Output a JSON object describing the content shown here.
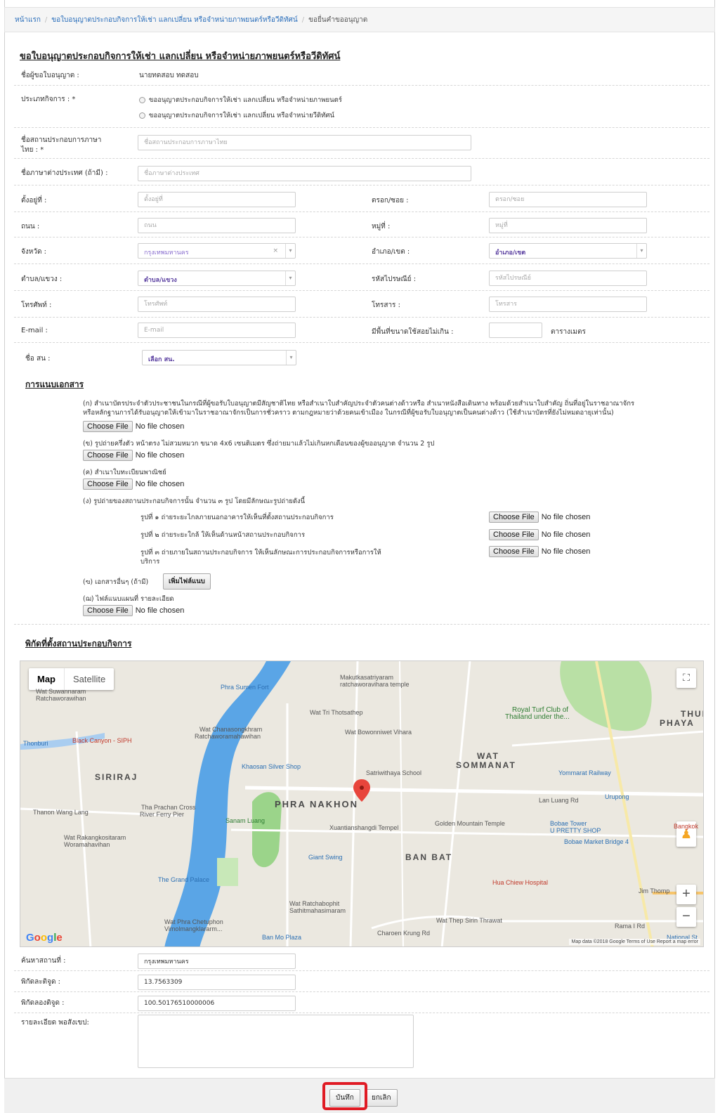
{
  "breadcrumb": {
    "home": "หน้าแรก",
    "section": "ขอใบอนุญาตประกอบกิจการให้เช่า แลกเปลี่ยน หรือจำหน่ายภาพยนตร์หรือวีดิทัศน์",
    "current": "ขอยื่นคำขออนุญาต"
  },
  "form": {
    "title": "ขอใบอนุญาตประกอบกิจการให้เช่า แลกเปลี่ยน หรือจำหน่ายภาพยนตร์หรือวีดิทัศน์",
    "applicant_label": "ชื่อผู้ขอใบอนุญาต :",
    "applicant_value": "นายทดสอบ ทดสอบ",
    "business_type_label": "ประเภทกิจการ : *",
    "business_type_options": [
      "ขออนุญาตประกอบกิจการให้เช่า แลกเปลี่ยน หรือจำหน่ายภาพยนตร์",
      "ขออนุญาตประกอบกิจการให้เช่า แลกเปลี่ยน หรือจำหน่ายวีดิทัศน์"
    ],
    "thai_name_label_1": "ชื่อสถานประกอบการภาษา",
    "thai_name_label_2": "ไทย : *",
    "thai_name_placeholder": "ชื่อสถานประกอบการภาษาไทย",
    "foreign_name_label": "ชื่อภาษาต่างประเทศ (ถ้ามี) :",
    "foreign_name_placeholder": "ชื่อภาษาต่างประเทศ",
    "address_label": "ตั้งอยู่ที่ :",
    "address_placeholder": "ตั้งอยู่ที่",
    "alley_label": "ตรอก/ซอย :",
    "alley_placeholder": "ตรอก/ซอย",
    "road_label": "ถนน :",
    "road_placeholder": "ถนน",
    "moo_label": "หมู่ที่ :",
    "moo_placeholder": "หมู่ที่",
    "province_label": "จังหวัด :",
    "province_value": "กรุงเทพมหานคร",
    "district_label": "อำเภอ/เขต :",
    "district_value": "อำเภอ/เขต",
    "subdistrict_label": "ตำบล/แขวง :",
    "subdistrict_value": "ตำบล/แขวง",
    "postcode_label": "รหัสไปรษณีย์ :",
    "postcode_placeholder": "รหัสไปรษณีย์",
    "phone_label": "โทรศัพท์ :",
    "phone_placeholder": "โทรศัพท์",
    "fax_label": "โทรสาร :",
    "fax_placeholder": "โทรสาร",
    "email_label": "E-mail :",
    "email_placeholder": "E-mail",
    "area_label": "มีพื้นที่ขนาดใช้สอยไม่เกิน :",
    "area_unit": "ตารางเมตร",
    "office_label": "ชื่อ สน :",
    "office_value": "เลือก สน."
  },
  "documents": {
    "title": "การแนบเอกสาร",
    "doc_a_line1": "(ก) สำเนาบัตรประจำตัวประชาชนในกรณีที่ผู้ขอรับใบอนุญาตมีสัญชาติไทย หรือสำเนาใบสำคัญประจำตัวคนต่างด้าวหรือ สำเนาหนังสือเดินทาง พร้อมด้วยสำเนาใบสำคัญ ถิ่นที่อยู่ในราชอาณาจักร",
    "doc_a_line2": "หรือหลักฐานการได้รับอนุญาตให้เข้ามาในราชอาณาจักรเป็นการชั่วคราว ตามกฎหมายว่าด้วยคนเข้าเมือง ในกรณีที่ผู้ขอรับใบอนุญาตเป็นคนต่างด้าว (ใช้สำเนาบัตรที่ยังไม่หมดอายุเท่านั้น)",
    "doc_b": "(ข) รูปถ่ายครึ่งตัว หน้าตรง ไม่สวมหมวก ขนาด 4x6 เซนติเมตร ซึ่งถ่ายมาแล้วไม่เกินหกเดือนของผู้ขออนุญาต จำนวน 2 รูป",
    "doc_c": "(ค) สำเนาใบทะเบียนพาณิชย์",
    "doc_d": "(ง) รูปถ่ายของสถานประกอบกิจการนั้น จำนวน ๓ รูป โดยมีลักษณะรูปถ่ายดังนี้",
    "photo_1": "รูปที่ ๑ ถ่ายระยะไกลภายนอกอาคารให้เห็นที่ตั้งสถานประกอบกิจการ",
    "photo_2": "รูปที่ ๒ ถ่ายระยะใกล้ ให้เห็นด้านหน้าสถานประกอบกิจการ",
    "photo_3_line1": "รูปที่ ๓ ถ่ายภายในสถานประกอบกิจการ ให้เห็นลักษณะการประกอบกิจการหรือการให้",
    "photo_3_line2": "บริการ",
    "doc_e": "(ฃ) เอกสารอื่นๆ (ถ้ามี)",
    "add_file_button": "เพิ่มไฟล์แนบ",
    "doc_f": "(ฌ) ไฟล์แนบแผนที่ รายละเอียด",
    "choose_file": "Choose File",
    "no_file": "No file chosen"
  },
  "location": {
    "title": "พิกัดที่ตั้งสถานประกอบกิจการ",
    "map_tab_map": "Map",
    "map_tab_satellite": "Satellite",
    "map_labels": {
      "phra_sumen": "Phra Sumen Fort",
      "makut": "Makutkasatriyaram",
      "makut2": "ratchaworavihara temple",
      "royal_turf": "Royal Turf Club of",
      "royal_turf2": "Thailand under the...",
      "wat_suwannaram": "Wat Suwannaram",
      "ratchaworawihan": "Ratchaworawihan",
      "wat_tri": "Wat Tri Thotsathep",
      "wat_chana": "Wat Chanasongkhram",
      "wat_chana2": "Ratchaworamahawihan",
      "wat_bowon": "Wat Bowonniwet Vihara",
      "thonburi": "Thonburi",
      "black_canyon": "Black Canyon - SIPH",
      "wat_sommanat": "WAT",
      "wat_sommanat2": "SOMMANAT",
      "khaosan": "Khaosan Silver Shop",
      "satri": "Satriwithaya School",
      "yommarat": "Yommarat Railway",
      "siriraj": "SIRIRAJ",
      "thai_phaya": "THUI",
      "thai_phaya2": "PHAYA",
      "phra_nakhon": "PHRA NAKHON",
      "lan_luang": "Lan Luang Rd",
      "urupong": "Urupong",
      "tha_prachan": "Tha Prachan Cross",
      "tha_prachan2": "River Ferry Pier",
      "sanam_luang": "Sanam Luang",
      "xuantian": "Xuantianshangdi Tempel",
      "golden_mountain": "Golden Mountain Temple",
      "bobae": "Bobae Tower",
      "bobae2": "U PRETTY SHOP",
      "bobae_bridge": "Bobae Market Bridge 4",
      "bangkok": "Bangkok",
      "thanon_wang_lang": "Thanon Wang Lang",
      "wat_rakang": "Wat Rakangkositaram",
      "wat_rakang2": "Woramahavihan",
      "giant_swing": "Giant Swing",
      "ban_bat": "BAN BAT",
      "grand_palace": "The Grand Palace",
      "hua_chiew": "Hua Chiew Hospital",
      "jim_thomp": "Jim Thomp",
      "wat_ratchabophit": "Wat Ratchabophit",
      "wat_ratchabophit2": "Sathitmahasimaram",
      "wat_phra_chetuphon": "Wat Phra Chetuphon",
      "wat_phra_chetuphon2": "Vimolmangklararm...",
      "ban_mo": "Ban Mo Plaza",
      "wat_thep_sirin": "Wat Thep Sirin Thrawat",
      "rama": "Rama I Rd",
      "national": "National St",
      "charoen": "Charoen Krung Rd",
      "google": "Google",
      "attribution": "Map data ©2018 Google   Terms of Use   Report a map error"
    },
    "search_label": "ค้นหาสถานที่ :",
    "search_value": "กรุงเทพมหานคร",
    "lat_label": "พิกัดละติจูด :",
    "lat_value": "13.7563309",
    "lng_label": "พิกัดลองติจูด :",
    "lng_value": "100.50176510000006",
    "detail_label": "รายละเอียด พอสังเขป:"
  },
  "footer": {
    "save": "บันทึก",
    "cancel": "ยกเลิก"
  },
  "colors": {
    "highlight": "#e01b24",
    "link": "#2a6ebb",
    "select_text": "#5a3fa0",
    "water": "#5aa5e6",
    "park": "#9bd48a"
  }
}
